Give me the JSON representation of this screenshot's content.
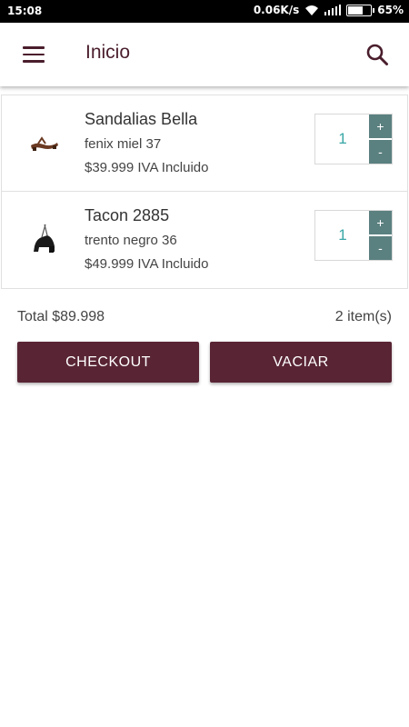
{
  "status_bar": {
    "time": "15:08",
    "network_speed": "0.06K/s",
    "battery": "65%",
    "battery_level": 0.65
  },
  "toolbar": {
    "title": "Inicio",
    "menu_icon": "menu-icon",
    "search_icon": "search-icon"
  },
  "cart": {
    "items": [
      {
        "name": "Sandalias Bella",
        "variant": "fenix miel 37",
        "price": "$39.999 IVA Incluido",
        "quantity": "1",
        "plus_label": "+",
        "minus_label": "-",
        "icon": "sandal-icon"
      },
      {
        "name": "Tacon 2885",
        "variant": "trento negro 36",
        "price": "$49.999 IVA Incluido",
        "quantity": "1",
        "plus_label": "+",
        "minus_label": "-",
        "icon": "heel-shoe-icon"
      }
    ]
  },
  "summary": {
    "total": "Total $89.998",
    "count": "2 item(s)"
  },
  "actions": {
    "checkout_label": "CHECKOUT",
    "clear_label": "VACIAR"
  },
  "colors": {
    "brand": "#592535",
    "title": "#4a1e2c",
    "qty_button": "#5b8080",
    "qty_value": "#3aa7a7"
  }
}
